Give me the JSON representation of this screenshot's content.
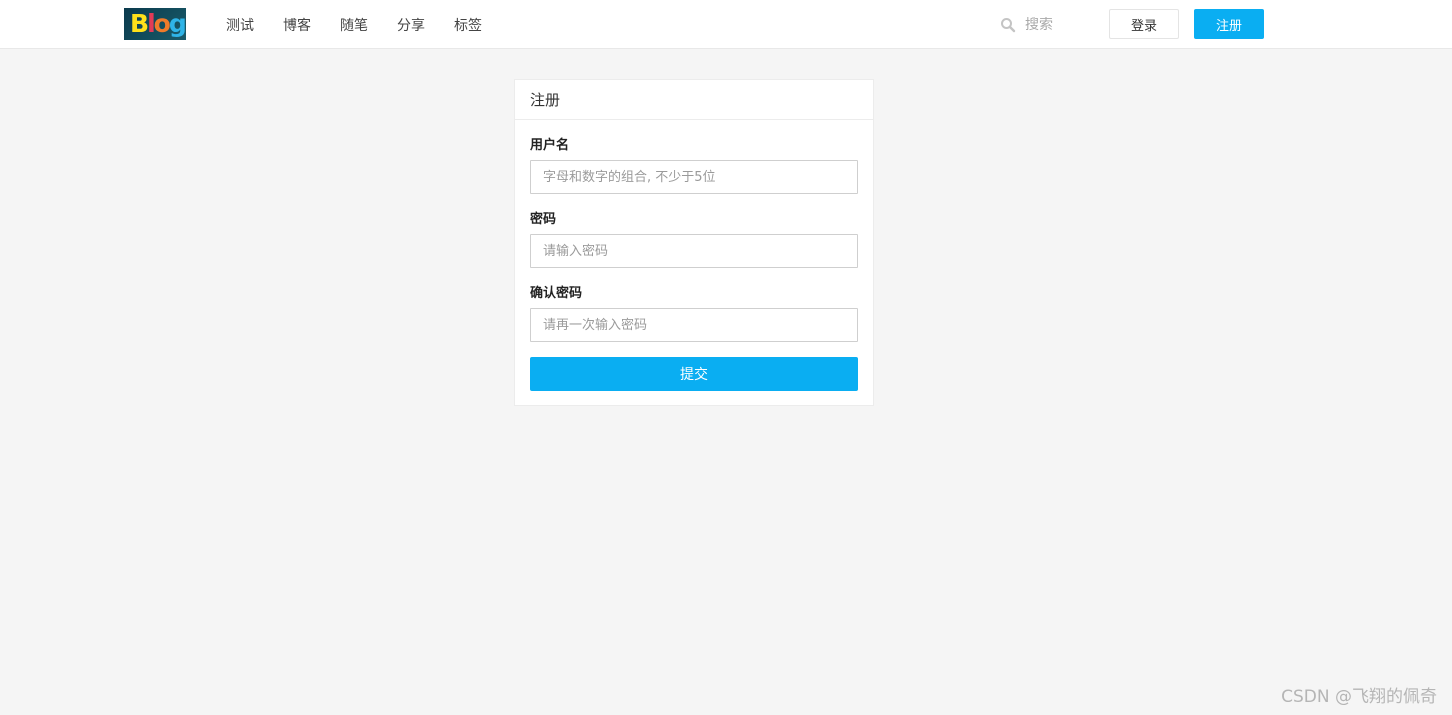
{
  "header": {
    "logo_text": [
      "B",
      "l",
      "o",
      "g"
    ],
    "nav": [
      {
        "label": "测试"
      },
      {
        "label": "博客"
      },
      {
        "label": "随笔"
      },
      {
        "label": "分享"
      },
      {
        "label": "标签"
      }
    ],
    "search": {
      "placeholder": "搜索",
      "value": ""
    },
    "login_label": "登录",
    "register_label": "注册"
  },
  "form": {
    "title": "注册",
    "fields": [
      {
        "label": "用户名",
        "placeholder": "字母和数字的组合, 不少于5位",
        "value": ""
      },
      {
        "label": "密码",
        "placeholder": "请输入密码",
        "value": ""
      },
      {
        "label": "确认密码",
        "placeholder": "请再一次输入密码",
        "value": ""
      }
    ],
    "submit_label": "提交"
  },
  "watermark": "CSDN @飞翔的佩奇",
  "colors": {
    "accent": "#0aaef2",
    "background": "#f5f5f5"
  }
}
